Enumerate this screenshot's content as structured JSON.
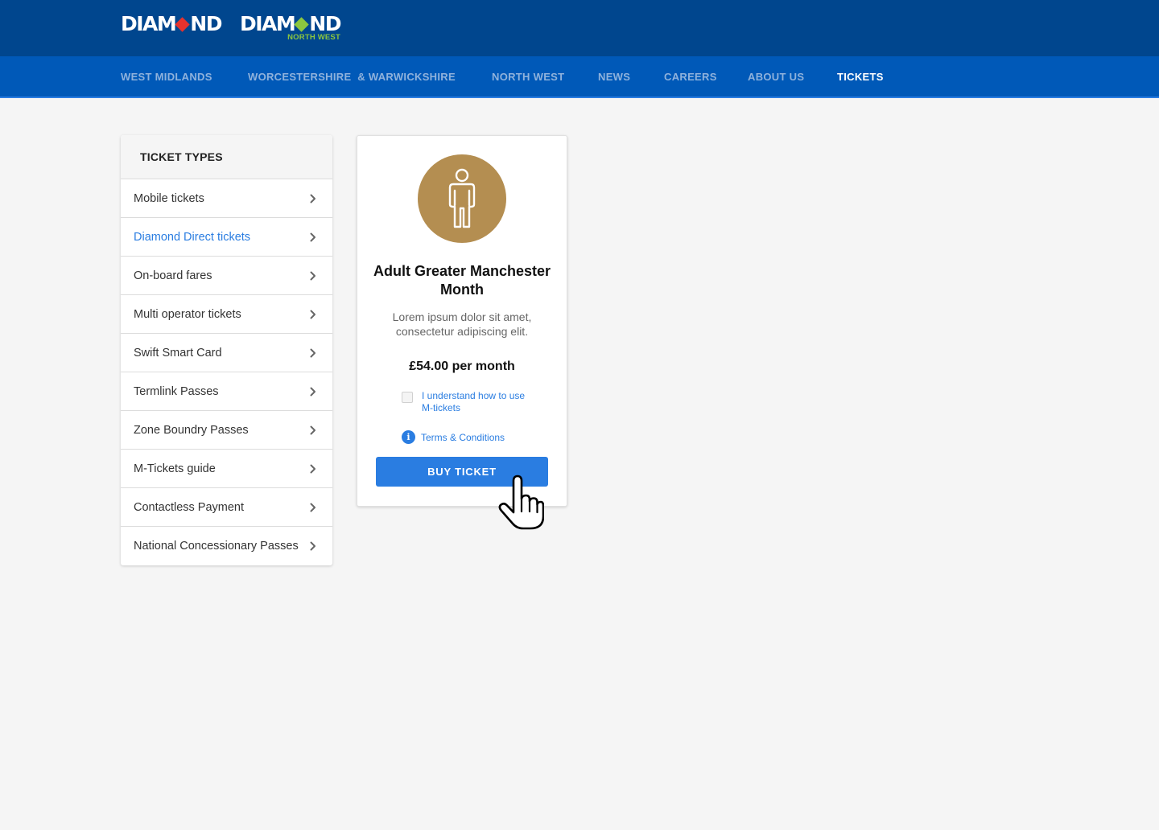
{
  "header": {
    "logos": [
      {
        "word_left": "DIAM",
        "word_right": "ND",
        "diamond_color": "#e6322d",
        "subtitle": ""
      },
      {
        "word_left": "DIAM",
        "word_right": "ND",
        "diamond_color": "#8cc63f",
        "subtitle": "NORTH WEST"
      }
    ],
    "colors": {
      "topbar": "#00468e",
      "navbar": "#0059b8",
      "accent": "#2a7de1"
    }
  },
  "nav": {
    "items": [
      {
        "label": "WEST MIDLANDS",
        "active": false
      },
      {
        "label": "WORCESTERSHIRE  & WARWICKSHIRE",
        "active": false
      },
      {
        "label": "NORTH WEST",
        "active": false
      },
      {
        "label": "NEWS",
        "active": false
      },
      {
        "label": "CAREERS",
        "active": false
      },
      {
        "label": "ABOUT US",
        "active": false
      },
      {
        "label": "TICKETS",
        "active": true
      }
    ]
  },
  "sidebar": {
    "heading": "TICKET TYPES",
    "items": [
      {
        "label": "Mobile tickets",
        "active": false
      },
      {
        "label": "Diamond Direct tickets",
        "active": true
      },
      {
        "label": "On-board fares",
        "active": false
      },
      {
        "label": "Multi operator tickets",
        "active": false
      },
      {
        "label": "Swift Smart Card",
        "active": false
      },
      {
        "label": "Termlink Passes",
        "active": false
      },
      {
        "label": "Zone Boundry Passes",
        "active": false
      },
      {
        "label": "M-Tickets guide",
        "active": false
      },
      {
        "label": "Contactless Payment",
        "active": false
      },
      {
        "label": "National Concessionary Passes",
        "active": false
      }
    ]
  },
  "ticket_card": {
    "icon": "person-icon",
    "icon_bg_color": "#b48e51",
    "title": "Adult Greater Manchester Month",
    "description": "Lorem ipsum dolor sit amet, consectetur adipiscing elit.",
    "price": "£54.00 per month",
    "checkbox_label": "I understand how to use M-tickets",
    "checkbox_checked": false,
    "terms_label": "Terms & Conditions",
    "buy_label": "BUY TICKET"
  }
}
